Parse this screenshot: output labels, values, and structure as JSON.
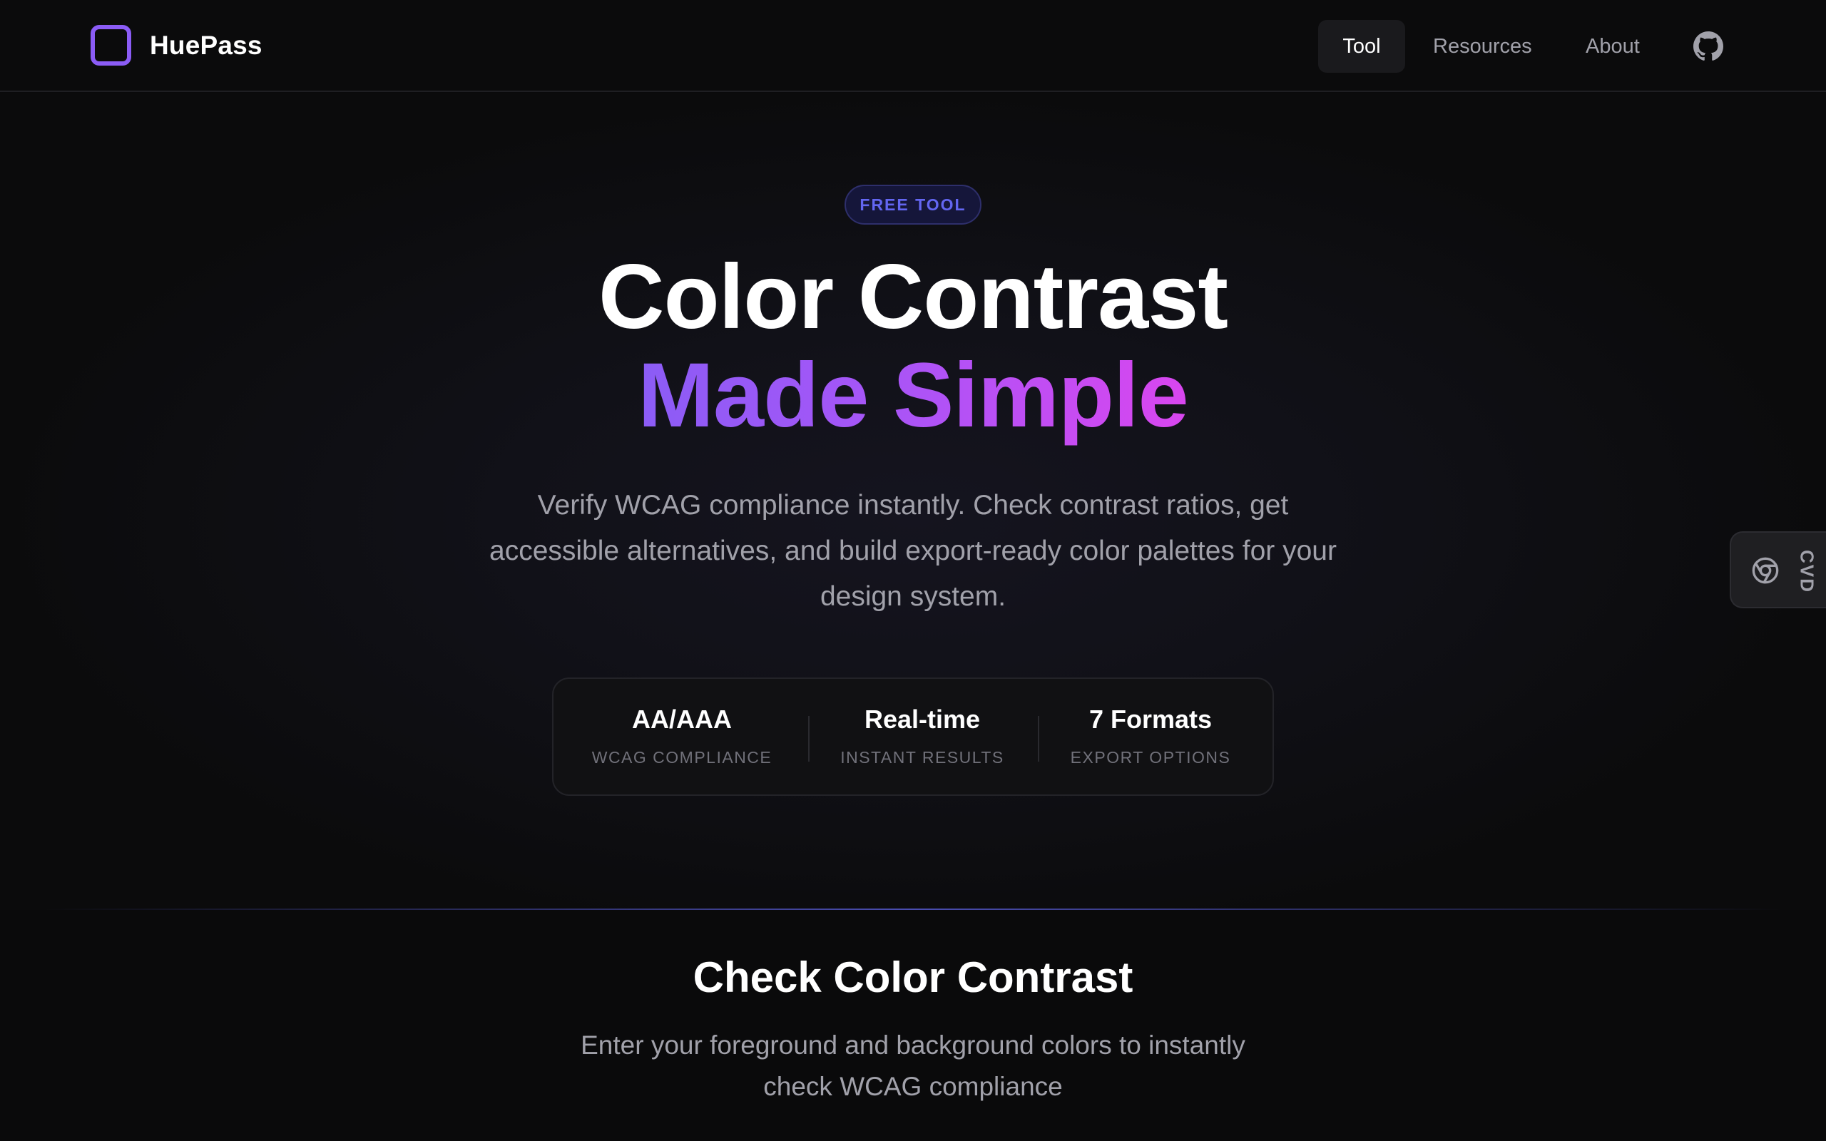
{
  "app": {
    "name": "HuePass"
  },
  "nav": {
    "items": [
      {
        "label": "Tool",
        "active": true
      },
      {
        "label": "Resources",
        "active": false
      },
      {
        "label": "About",
        "active": false
      }
    ],
    "github_icon": "github-icon"
  },
  "hero": {
    "badge": "FREE TOOL",
    "headline_line1": "Color Contrast",
    "headline_line2": "Made Simple",
    "subtitle": "Verify WCAG compliance instantly. Check contrast ratios, get accessible alternatives, and build export-ready color palettes for your design system.",
    "stats": [
      {
        "value": "AA/AAA",
        "label": "WCAG COMPLIANCE"
      },
      {
        "value": "Real-time",
        "label": "INSTANT RESULTS"
      },
      {
        "value": "7 Formats",
        "label": "EXPORT OPTIONS"
      }
    ]
  },
  "section": {
    "title": "Check Color Contrast",
    "subtitle": "Enter your foreground and background colors to instantly check WCAG compliance"
  },
  "cvd_tab": {
    "label": "CVD",
    "icon": "eye-icon"
  },
  "colors": {
    "background": "#0a0a0b",
    "accent_purple": "#8b5cf6",
    "accent_pink": "#d946ef",
    "badge_text": "#6366f1",
    "muted_text": "#a1a1aa"
  }
}
